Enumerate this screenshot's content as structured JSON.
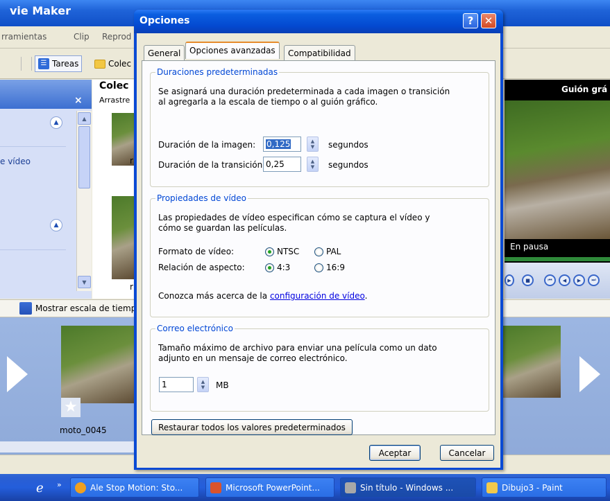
{
  "background": {
    "app_title": "vie Maker",
    "menu": [
      "rramientas",
      "Clip",
      "Reprod"
    ],
    "toolbar": {
      "tasks_label": "Tareas",
      "collections_label": "Colec"
    },
    "task_pane": {
      "link_text": "e vídeo",
      "close_glyph": "×"
    },
    "collection": {
      "title": "Colec",
      "hint": "Arrastre",
      "letter1": "r",
      "letter2": "r"
    },
    "monitor": {
      "title": "Guión grá",
      "status": "En pausa"
    },
    "storyboard": {
      "toggle_label": "Mostrar escala de tiemp",
      "clip_name": "moto_0045"
    }
  },
  "taskbar": {
    "items": [
      {
        "label": "Ale Stop Motion: Sto...",
        "color": "#f0a020"
      },
      {
        "label": "Microsoft PowerPoint...",
        "color": "#d9532c"
      },
      {
        "label": "Sin título - Windows ...",
        "color": "#a8a8a8"
      },
      {
        "label": "Dibujo3 - Paint",
        "color": "#f2c94c"
      }
    ]
  },
  "dialog": {
    "title": "Opciones",
    "help_glyph": "?",
    "close_glyph": "✕",
    "tabs": [
      "General",
      "Opciones avanzadas",
      "Compatibilidad"
    ],
    "durations": {
      "legend": "Duraciones predeterminadas",
      "description_line1": "Se asignará una duración predeterminada a cada imagen o transición",
      "description_line2": "al agregarla a la escala de tiempo o al guión gráfico.",
      "image_label": "Duración de la imagen:",
      "image_value": "0,125",
      "transition_label": "Duración de la transición:",
      "transition_value": "0,25",
      "unit": "segundos"
    },
    "video": {
      "legend": "Propiedades de vídeo",
      "description_line1": "Las propiedades de vídeo especifican cómo se captura el vídeo y",
      "description_line2": "cómo se guardan las películas.",
      "format_label": "Formato de vídeo:",
      "format_options": [
        "NTSC",
        "PAL"
      ],
      "format_selected": "NTSC",
      "aspect_label": "Relación de aspecto:",
      "aspect_options": [
        "4:3",
        "16:9"
      ],
      "aspect_selected": "4:3",
      "more_prefix": "Conozca más acerca de la ",
      "more_link": "configuración de vídeo",
      "more_suffix": "."
    },
    "email": {
      "legend": "Correo electrónico",
      "description_line1": "Tamaño máximo de archivo para enviar una película como un dato",
      "description_line2": "adjunto en un mensaje de correo electrónico.",
      "value": "1",
      "unit": "MB"
    },
    "restore_button": "Restaurar todos los valores predeterminados",
    "ok_button": "Aceptar",
    "cancel_button": "Cancelar"
  }
}
